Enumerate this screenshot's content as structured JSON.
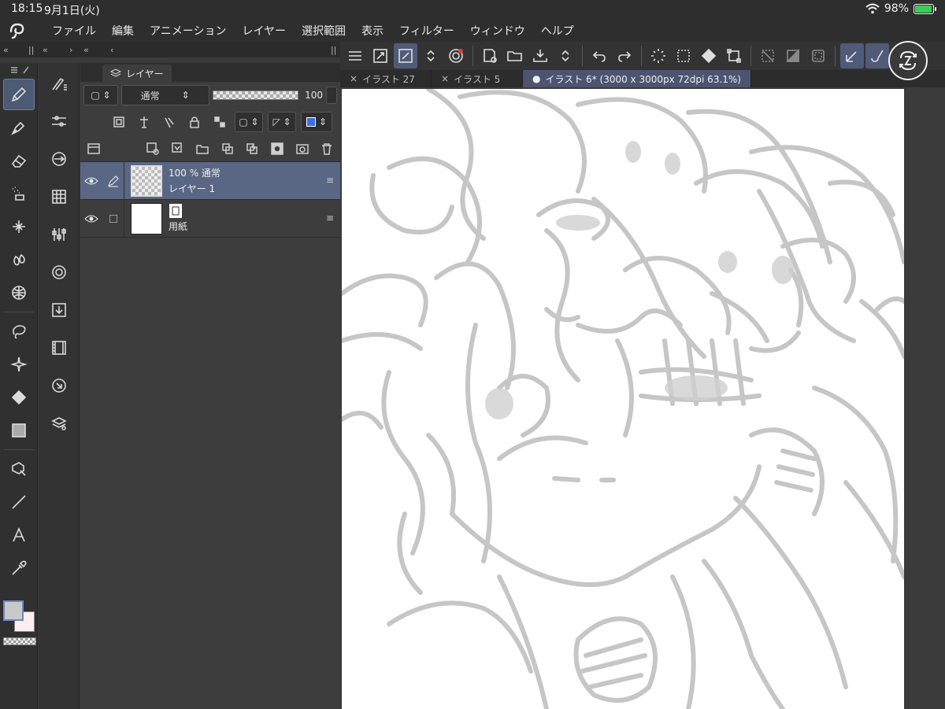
{
  "status": {
    "time": "18:15",
    "date": "9月1日(火)",
    "battery": "98%",
    "battery_level": 0.98
  },
  "menu": [
    "ファイル",
    "編集",
    "アニメーション",
    "レイヤー",
    "選択範囲",
    "表示",
    "フィルター",
    "ウィンドウ",
    "ヘルプ"
  ],
  "layer_panel": {
    "tab_label": "レイヤー",
    "blend_mode": "通常",
    "opacity": "100",
    "layers": [
      {
        "line1": "100 % 通常",
        "line2": "レイヤー 1"
      },
      {
        "line1": "",
        "line2": "用紙"
      }
    ]
  },
  "doc_tabs": [
    {
      "label": "イラスト 27",
      "prefix": "×"
    },
    {
      "label": "イラスト 5",
      "prefix": "×"
    },
    {
      "label": "イラスト 6* (3000 x 3000px 72dpi 63.1%)",
      "prefix": "●"
    }
  ],
  "colors": {
    "main": "#c9c9c9",
    "sub": "#fbeef2",
    "accent": "#5a6784"
  }
}
